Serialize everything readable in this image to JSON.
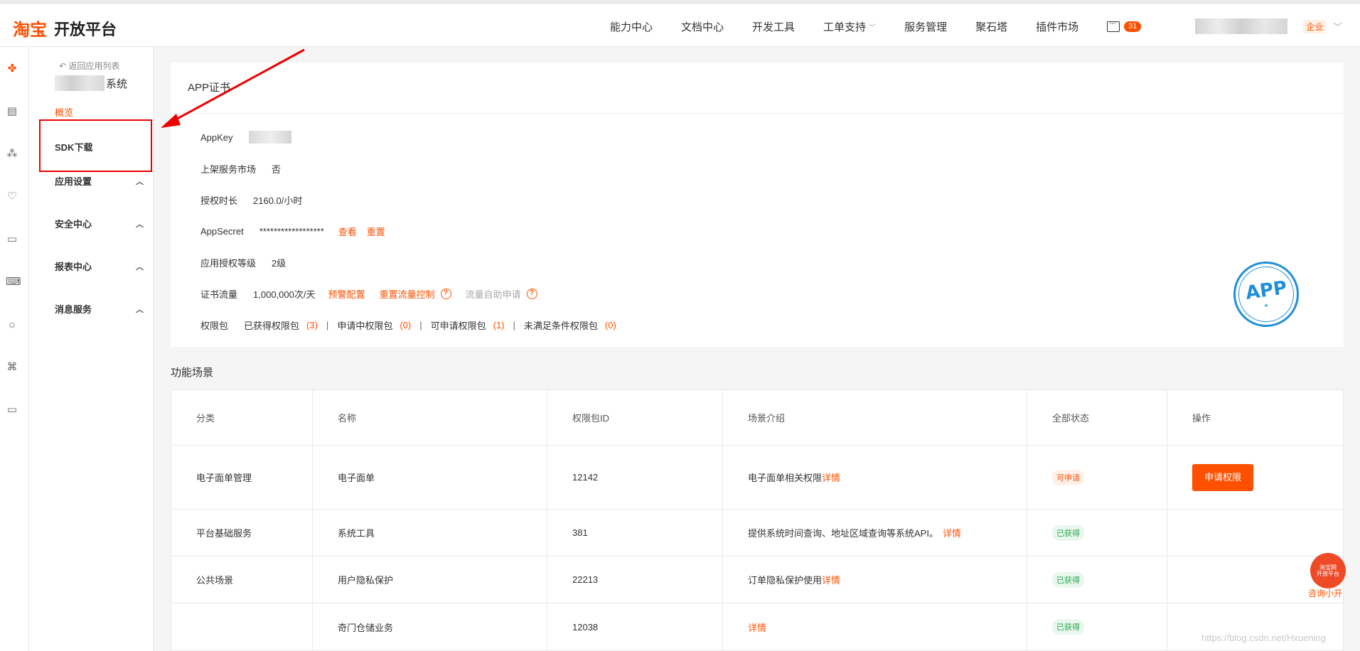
{
  "header": {
    "logo_brand": "淘宝",
    "logo_text": "开放平台",
    "nav": [
      "能力中心",
      "文档中心",
      "开发工具",
      "工单支持",
      "服务管理",
      "聚石塔",
      "插件市场"
    ],
    "msg_count": "31",
    "org_tag": "企业"
  },
  "sidebar": {
    "back_label": "返回应用列表",
    "app_suffix": "系统",
    "items": [
      {
        "label": "概览"
      },
      {
        "label": "SDK下载"
      },
      {
        "label": "应用设置"
      },
      {
        "label": "安全中心"
      },
      {
        "label": "报表中心"
      },
      {
        "label": "消息服务"
      }
    ]
  },
  "cert": {
    "title": "APP证书",
    "appkey_label": "AppKey",
    "market_label": "上架服务市场",
    "market_value": "否",
    "auth_label": "授权时长",
    "auth_value": "2160.0/小时",
    "secret_label": "AppSecret",
    "secret_value": "******************",
    "secret_view": "查看",
    "secret_reset": "重置",
    "level_label": "应用授权等级",
    "level_value": "2级",
    "flow_label": "证书流量",
    "flow_value": "1,000,000次/天",
    "flow_alarm": "预警配置",
    "flow_reset": "重置流量控制",
    "flow_self": "流量自助申请",
    "perm_label": "权限包",
    "perm_got": "已获得权限包",
    "perm_got_n": "(3)",
    "perm_applying": "申请中权限包",
    "perm_applying_n": "(0)",
    "perm_can": "可申请权限包",
    "perm_can_n": "(1)",
    "perm_unmet": "未满足条件权限包",
    "perm_unmet_n": "(0)",
    "stamp_text": "APP"
  },
  "section_title": "功能场景",
  "table": {
    "headers": [
      "分类",
      "名称",
      "权限包ID",
      "场景介绍",
      "全部状态",
      "操作"
    ],
    "rows": [
      {
        "cat": "电子面单管理",
        "name": "电子面单",
        "id": "12142",
        "intro": "电子面单相关权限",
        "detail": "详情",
        "status": "可申请",
        "action": "申请权限"
      },
      {
        "cat": "平台基础服务",
        "name": "系统工具",
        "id": "381",
        "intro": "提供系统时间查询、地址区域查询等系统API。",
        "detail": "详情",
        "status": "已获得",
        "action": ""
      },
      {
        "cat": "公共场景",
        "name": "用户隐私保护",
        "id": "22213",
        "intro": "订单隐私保护使用",
        "detail": "详情",
        "status": "已获得",
        "action": ""
      },
      {
        "cat": "",
        "name": "奇门仓储业务",
        "id": "12038",
        "intro": "",
        "detail": "详情",
        "status": "已获得",
        "action": ""
      }
    ]
  },
  "float": {
    "label": "咨询小开"
  },
  "watermark": "https://blog.csdn.net/Hxuening"
}
